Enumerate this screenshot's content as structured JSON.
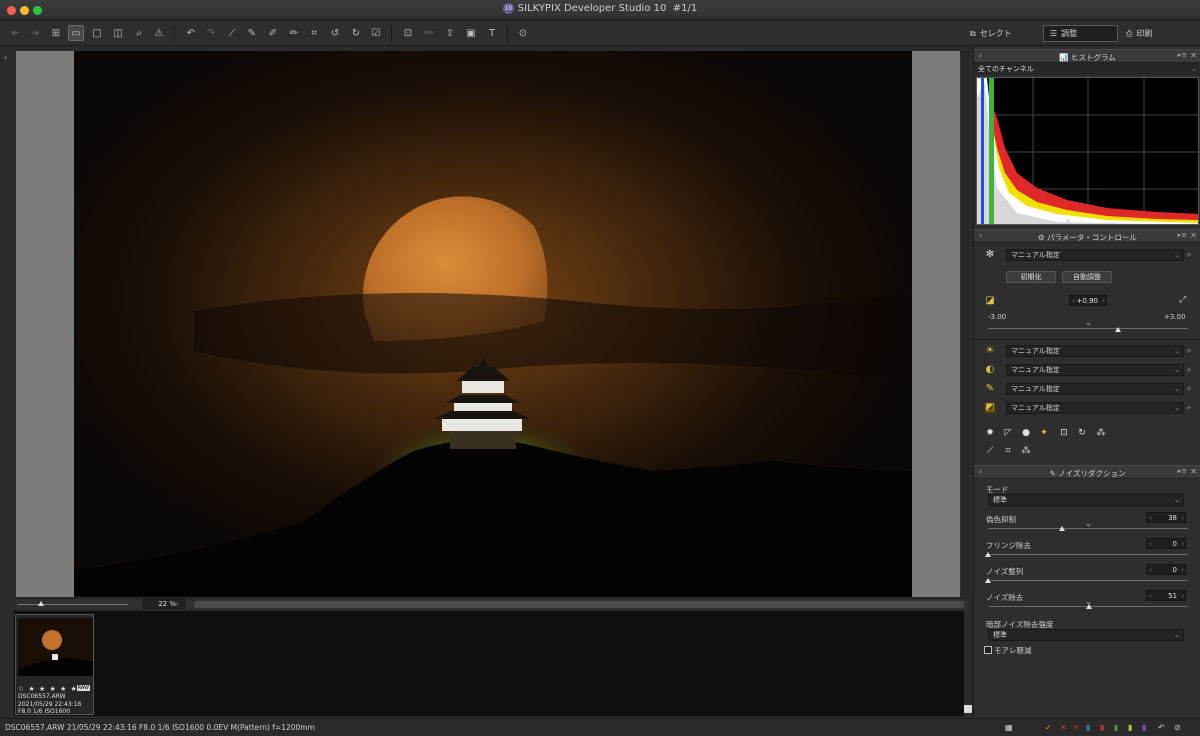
{
  "window": {
    "title": "SILKYPIX Developer Studio 10",
    "counter": "#1/1",
    "badge": "10",
    "colors": {
      "close": "#ff5f57",
      "minimize": "#febc2e",
      "zoom": "#28c840"
    }
  },
  "toolbar": {
    "modes": [
      {
        "label": "セレクト",
        "icon": "select-icon"
      },
      {
        "label": "調整",
        "icon": "sliders-icon"
      },
      {
        "label": "印刷",
        "icon": "printer-icon"
      }
    ]
  },
  "viewer": {
    "zoom": "22 %"
  },
  "filmstrip": {
    "items": [
      {
        "filename": "DSC06557.ARW",
        "datetime": "2021/05/29 22:43:16",
        "exposure": "F8.0 1/6 ISO1600",
        "stars": "☆ ★ ★ ★ ★ ★",
        "raw_badge": "RAW"
      }
    ]
  },
  "status": {
    "text": "DSC06557.ARW 21/05/29 22:43:16 F8.0 1/6 ISO1600 0.0EV M(Pattern) f=1200mm"
  },
  "histogram_panel": {
    "title": "ヒストグラム",
    "channel": "全てのチャンネル"
  },
  "param_panel": {
    "title": "パラメータ・コントロール",
    "preset": "マニュアル指定",
    "init_button": "初期化",
    "auto_button": "自動調整",
    "exposure_value": "+0.90",
    "exposure_min": "-3.00",
    "exposure_max": "+3.00",
    "exposure_level": 0.65,
    "wb": "マニュアル指定",
    "tone": "マニュアル指定",
    "sharpness": "マニュアル指定",
    "color": "マニュアル指定"
  },
  "noise_panel": {
    "title": "ノイズリダクション",
    "mode_label": "モード",
    "mode_value": "標準",
    "sliders": [
      {
        "label": "偽色抑制",
        "value": "38"
      },
      {
        "label": "フリンジ除去",
        "value": "0"
      },
      {
        "label": "ノイズ整列",
        "value": "0"
      },
      {
        "label": "ノイズ除去",
        "value": "51"
      }
    ],
    "dark_label": "暗部ノイズ除去強度",
    "dark_value": "標準",
    "moire_label": "モアレ軽減"
  }
}
